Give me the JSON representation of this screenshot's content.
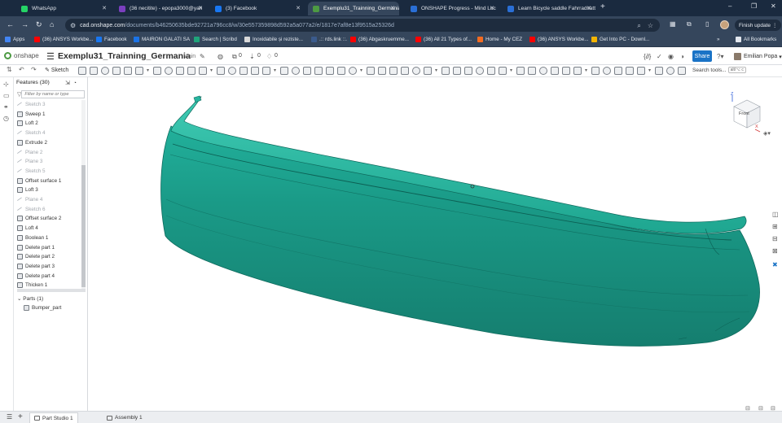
{
  "browser": {
    "tabs": [
      {
        "title": "WhatsApp",
        "color": "#25d366",
        "active": false
      },
      {
        "title": "(36 necitite) - epopa3000@yah",
        "color": "#7b3fbf",
        "active": false
      },
      {
        "title": "(3) Facebook",
        "color": "#1877f2",
        "active": false
      },
      {
        "title": "Exemplu31_Trainning_Germania",
        "color": "#4d9a43",
        "active": true
      },
      {
        "title": "ONSHAPE Progress - Mind Luc",
        "color": "#2a6fd6",
        "active": false
      },
      {
        "title": "Learn Bicycle saddle Fahrradsatt",
        "color": "#2a6fd6",
        "active": false
      }
    ],
    "url_host": "cad.onshape.com",
    "url_path": "/documents/b46250635bde92721a796cc8/w/30e557359898d592a5a077a2/e/1817e7af8e13f9515a25326d",
    "finish_update": "Finish update",
    "bookmarks": [
      {
        "label": "Apps",
        "color": "#4285f4"
      },
      {
        "label": "(36) ANSYS Workbe...",
        "color": "#ff0000"
      },
      {
        "label": "Facebook",
        "color": "#1877f2"
      },
      {
        "label": "MAIRON GALATI SA",
        "color": "#1a73e8"
      },
      {
        "label": "Search | Scribd",
        "color": "#1fa37a"
      },
      {
        "label": "Inoxidabile și rezistе...",
        "color": "#d9d9d9"
      },
      {
        "label": ".:: rds.link ::.",
        "color": "#3b5b8c"
      },
      {
        "label": "(36) Abgaskruemme...",
        "color": "#ff0000"
      },
      {
        "label": "(36) All 21 Types of...",
        "color": "#ff0000"
      },
      {
        "label": "Home - My CEZ",
        "color": "#f26b21"
      },
      {
        "label": "(36) ANSYS Workbe...",
        "color": "#ff0000"
      },
      {
        "label": "Get Into PC - Downl...",
        "color": "#f4b400"
      },
      {
        "label": "All Bookmarks",
        "color": "#e3e8ef"
      }
    ]
  },
  "onshape": {
    "logo": "onshape",
    "document_name": "Exemplu31_Trainning_Germania",
    "branch": "Main",
    "counts": [
      "0",
      "0",
      "0"
    ],
    "share_label": "Share",
    "user_name": "Emilian Popa",
    "sketch_label": "Sketch",
    "search_tools": "Search tools...",
    "search_shortcut": "alt/⌥ c"
  },
  "features": {
    "title": "Features (30)",
    "filter_placeholder": "Filter by name or type",
    "items": [
      {
        "label": "Sketch 3",
        "kind": "sketch",
        "dim": true
      },
      {
        "label": "Sweep 1",
        "kind": "op",
        "dim": false
      },
      {
        "label": "Loft 2",
        "kind": "op",
        "dim": false
      },
      {
        "label": "Sketch 4",
        "kind": "sketch",
        "dim": true
      },
      {
        "label": "Extrude 2",
        "kind": "op",
        "dim": false
      },
      {
        "label": "Plane 2",
        "kind": "sketch",
        "dim": true
      },
      {
        "label": "Plane 3",
        "kind": "sketch",
        "dim": true
      },
      {
        "label": "Sketch 5",
        "kind": "sketch",
        "dim": true
      },
      {
        "label": "Offset surface 1",
        "kind": "op",
        "dim": false
      },
      {
        "label": "Loft 3",
        "kind": "op",
        "dim": false
      },
      {
        "label": "Plane 4",
        "kind": "sketch",
        "dim": true
      },
      {
        "label": "Sketch 6",
        "kind": "sketch",
        "dim": true
      },
      {
        "label": "Offset surface 2",
        "kind": "op",
        "dim": false
      },
      {
        "label": "Loft 4",
        "kind": "op",
        "dim": false
      },
      {
        "label": "Boolean 1",
        "kind": "op",
        "dim": false
      },
      {
        "label": "Delete part 1",
        "kind": "op",
        "dim": false
      },
      {
        "label": "Delete part 2",
        "kind": "op",
        "dim": false
      },
      {
        "label": "Delete part 3",
        "kind": "op",
        "dim": false
      },
      {
        "label": "Delete part 4",
        "kind": "op",
        "dim": false
      },
      {
        "label": "Thicken 1",
        "kind": "op",
        "dim": false
      }
    ],
    "parts_header": "Parts (1)",
    "part": "Bumper_part"
  },
  "viewcube": {
    "front": "Front",
    "top": "Top",
    "axis_x": "X",
    "axis_z": "Z"
  },
  "model_color": "#1a9a87",
  "bottom_tabs": [
    {
      "label": "Part Studio 1",
      "active": true
    },
    {
      "label": "Assembly 1",
      "active": false
    }
  ]
}
